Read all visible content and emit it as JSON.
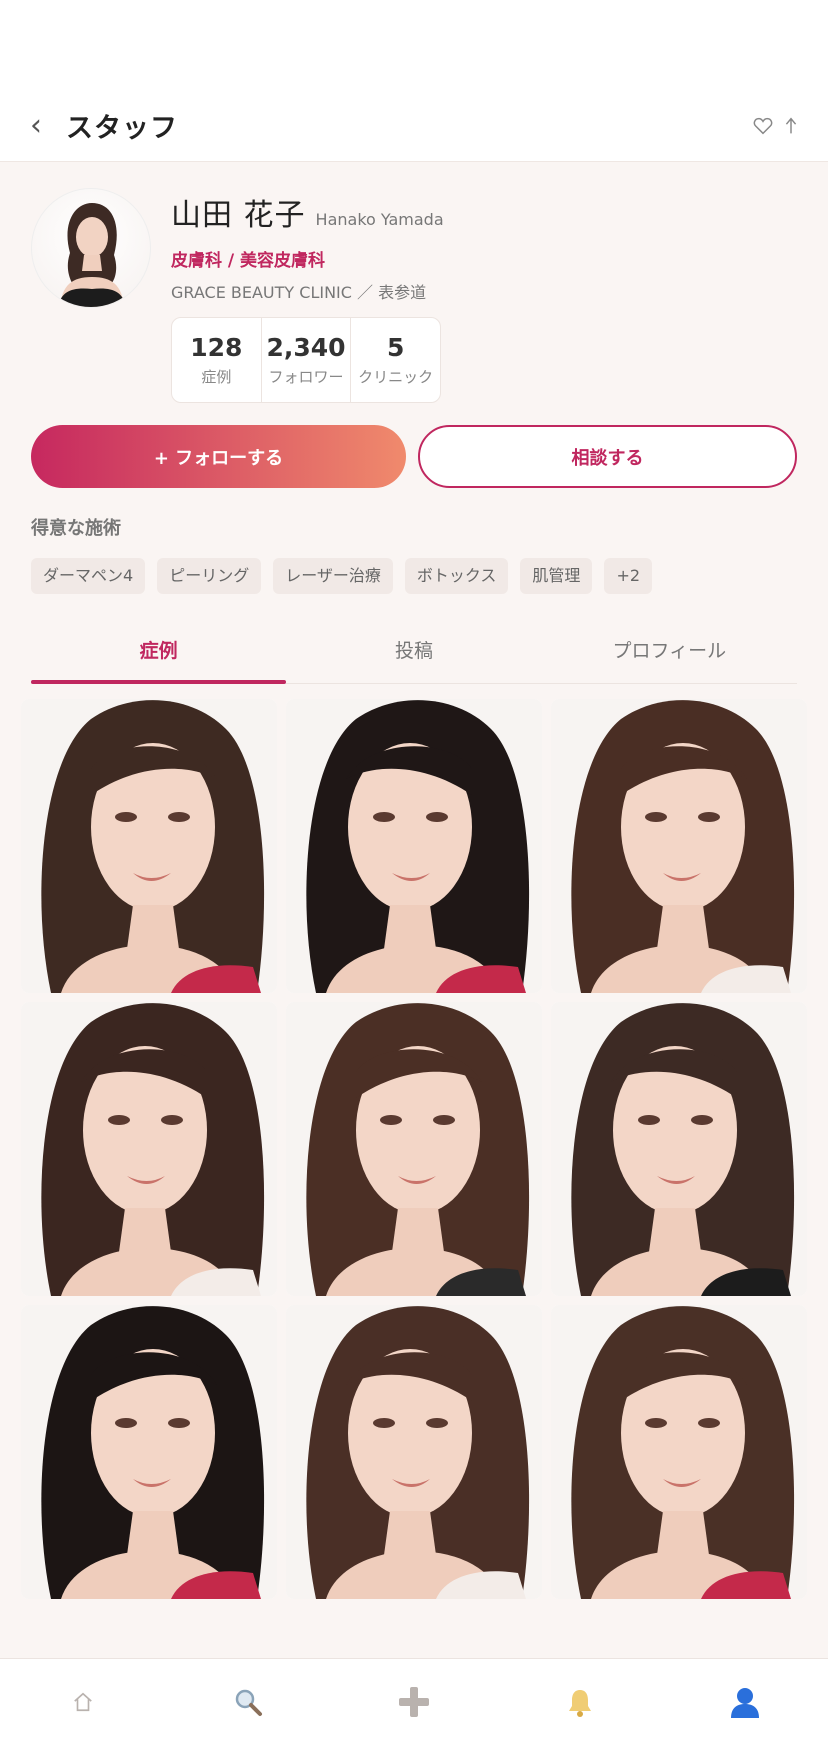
{
  "header": {
    "back_icon": "chevron-left-icon",
    "title": "スタッフ",
    "actions": [
      "heart-icon",
      "share-icon"
    ]
  },
  "profile": {
    "name": "山田 花子",
    "name_en": "Hanako Yamada",
    "specialty": "皮膚科 / 美容皮膚科",
    "clinic": "GRACE BEAUTY CLINIC ／ 表参道",
    "stats": [
      {
        "value": "128",
        "label": "症例"
      },
      {
        "value": "2,340",
        "label": "フォロワー"
      },
      {
        "value": "5",
        "label": "クリニック"
      }
    ]
  },
  "actions": {
    "follow_label": "+ フォローする",
    "consult_label": "相談する"
  },
  "skills": {
    "title": "得意な施術",
    "tags": [
      "ダーマペン4",
      "ピーリング",
      "レーザー治療",
      "ボトックス",
      "肌管理",
      "+2"
    ]
  },
  "tabs": [
    {
      "label": "症例",
      "active": true
    },
    {
      "label": "投稿",
      "active": false
    },
    {
      "label": "プロフィール",
      "active": false
    }
  ],
  "gallery": {
    "items": [
      {
        "hair": "#3e2a22",
        "top": "#c4294a"
      },
      {
        "hair": "#1f1716",
        "top": "#c4294a"
      },
      {
        "hair": "#4a2e24",
        "top": "#f3ece8"
      },
      {
        "hair": "#3b2620",
        "top": "#f3ece8"
      },
      {
        "hair": "#4b2f25",
        "top": "#2a2a2a"
      },
      {
        "hair": "#3d2a24",
        "top": "#1c1c1c"
      },
      {
        "hair": "#1c1514",
        "top": "#c4294a"
      },
      {
        "hair": "#4a2f26",
        "top": "#f3ece8"
      },
      {
        "hair": "#4a3026",
        "top": "#c4294a"
      }
    ]
  },
  "bottom_nav": [
    {
      "icon": "home-icon",
      "color": "#b9b2ae"
    },
    {
      "icon": "search-icon",
      "color": "#b9b2ae"
    },
    {
      "icon": "plus-icon",
      "color": "#b9b2ae"
    },
    {
      "icon": "bell-icon",
      "color": "#e7c36a"
    },
    {
      "icon": "user-icon",
      "color": "#2a6fdb"
    }
  ],
  "colors": {
    "accent": "#c0275f",
    "gradient_end": "#f08a6c",
    "background": "#faf5f3"
  }
}
